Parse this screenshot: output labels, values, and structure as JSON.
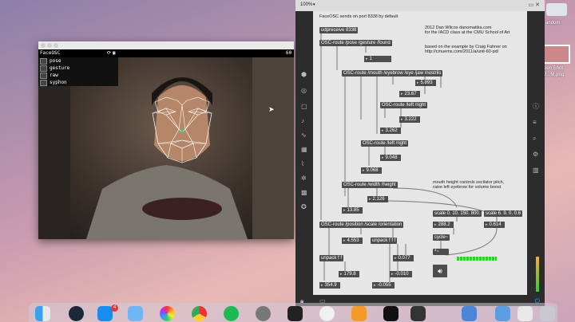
{
  "desktop": {
    "label_top_right": "andom",
    "screenshot_label": "een Shot\n2...M.png"
  },
  "faceosc": {
    "title": "FaceOSC",
    "fps": "60",
    "menu": [
      "pose",
      "gesture",
      "raw",
      "syphon"
    ]
  },
  "max": {
    "zoom": "100%",
    "header_comment": "FaceOSC sends on port 8338 by default",
    "credit_lines": [
      "2012 Dan Wilcox danomatika.com",
      "for the IACD class at the CMU School of Art"
    ],
    "based_lines": [
      "based on the example by Craig Fahner on",
      "http://cmuems.com/2011/a/unit-60-pd/"
    ],
    "mouth_comment": [
      "mouth height controls oscilator pitch,",
      "raise left eyebrow for volume boost"
    ],
    "objects": {
      "udpreceive": "udpreceive 8338",
      "route_pose": "OSC-route /pose /gesture /found",
      "route_mouth": "OSC-route /mouth /eyebrow /eye /jaw /nostrils",
      "route_left_right": "OSC-route /left /right",
      "route_left_right2": "OSC-route /left /right",
      "route_width": "OSC-route /width /height",
      "route_position": "OSC-route /position /scale /orientation",
      "unpack_ff": "unpack f f",
      "unpack_fff": "unpack f f f",
      "scale_a": "scale 0. 10. 150. 800.",
      "scale_b": "scale 6. 9. 0. 0.6",
      "cycle": "cycle~",
      "mult": "*~"
    },
    "numbers": {
      "found": "1",
      "n5893": "5.893",
      "n2367": "23.67",
      "n3222": "3.222",
      "n3262": "3.262",
      "n9048": "9.048",
      "n9068": "9.068",
      "n2126": "2.126",
      "n1385": "13.85",
      "n2882": "288.2",
      "n0614": "0.614",
      "n4553": "4.553",
      "n0077": "0.077",
      "n1798": "179.8",
      "n0010": "-0.010",
      "n3549": "354.9",
      "n0055": "-0.055"
    }
  },
  "dock": {
    "appstore_badge": "4"
  },
  "colors": {
    "max_canvas": "#e6e6e6",
    "max_object": "#4d4d4d",
    "max_chrome": "#2c2c2c",
    "face_mesh": "#ffffff"
  }
}
